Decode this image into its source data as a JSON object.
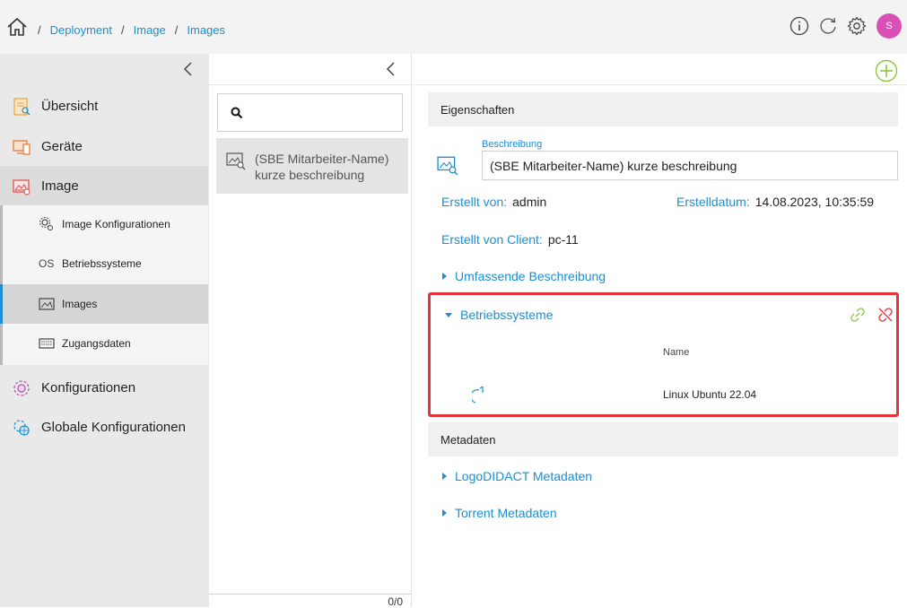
{
  "header": {
    "breadcrumb": [
      {
        "label": "Deployment"
      },
      {
        "label": "Image"
      },
      {
        "label": "Images"
      }
    ],
    "separator": "/",
    "avatar_initial": "S",
    "colors": {
      "link": "#1a8fd1",
      "avatar": "#d94fb6",
      "highlight": "#e8313a"
    }
  },
  "sidebar": {
    "items": [
      {
        "label": "Übersicht",
        "icon": "overview-icon"
      },
      {
        "label": "Geräte",
        "icon": "devices-icon"
      },
      {
        "label": "Image",
        "icon": "image-icon"
      },
      {
        "label": "Konfigurationen",
        "icon": "configurations-icon"
      },
      {
        "label": "Globale Konfigurationen",
        "icon": "global-configurations-icon"
      }
    ],
    "subitems": [
      {
        "label": "Image Konfigurationen",
        "icon": "gears-icon"
      },
      {
        "label": "Betriebssysteme",
        "icon_text": "OS"
      },
      {
        "label": "Images",
        "icon": "image-small-icon"
      },
      {
        "label": "Zugangsdaten",
        "icon": "keyboard-icon"
      }
    ]
  },
  "list": {
    "search_placeholder": "",
    "items": [
      {
        "label": "(SBE Mitarbeiter-Name) kurze beschreibung"
      }
    ],
    "pager": "0/0"
  },
  "detail": {
    "eigenschaften_title": "Eigenschaften",
    "beschreibung_label": "Beschreibung",
    "beschreibung_value": "(SBE Mitarbeiter-Name) kurze beschreibung",
    "erstellt_von_label": "Erstellt von:",
    "erstellt_von_value": "admin",
    "erstelldatum_label": "Erstelldatum:",
    "erstelldatum_value": "14.08.2023, 10:35:59",
    "erstellt_client_label": "Erstellt von Client:",
    "erstellt_client_value": "pc-11",
    "umfassende_label": "Umfassende Beschreibung",
    "os_section": {
      "title": "Betriebssysteme",
      "column_name": "Name",
      "rows": [
        {
          "name": "Linux Ubuntu 22.04"
        }
      ]
    },
    "metadaten_title": "Metadaten",
    "logodidact_label": "LogoDIDACT Metadaten",
    "torrent_label": "Torrent Metadaten"
  }
}
